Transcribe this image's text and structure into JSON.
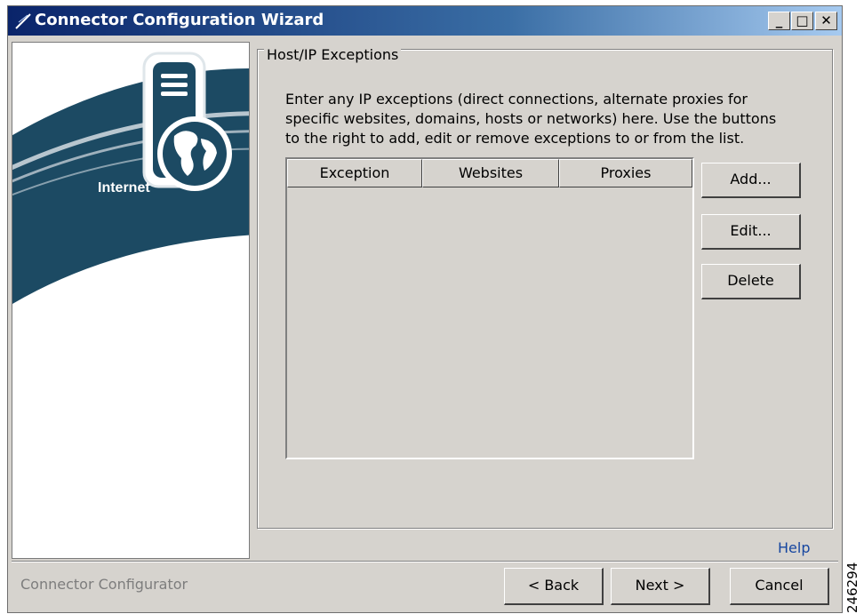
{
  "window": {
    "title": "Connector Configuration Wizard",
    "minimize_glyph": "_",
    "maximize_glyph": "□",
    "close_glyph": "✕"
  },
  "banner": {
    "label": "Internet"
  },
  "section": {
    "legend": "Host/IP Exceptions",
    "description": "Enter any IP exceptions (direct connections, alternate proxies for specific websites, domains, hosts or networks) here. Use the buttons to the right to add, edit or remove exceptions to or from the list."
  },
  "exceptions_table": {
    "columns": [
      "Exception",
      "Websites",
      "Proxies"
    ],
    "rows": []
  },
  "actions": {
    "add": "Add...",
    "edit": "Edit...",
    "delete": "Delete"
  },
  "help_link": "Help",
  "footer": {
    "status": "Connector Configurator",
    "back": "< Back",
    "next": "Next >",
    "cancel": "Cancel"
  },
  "figure_number": "246294",
  "colors": {
    "title_gradient_start": "#0a246a",
    "window_bg": "#d6d3ce",
    "banner_navy": "#1c4a63",
    "help_link": "#1646a0"
  }
}
